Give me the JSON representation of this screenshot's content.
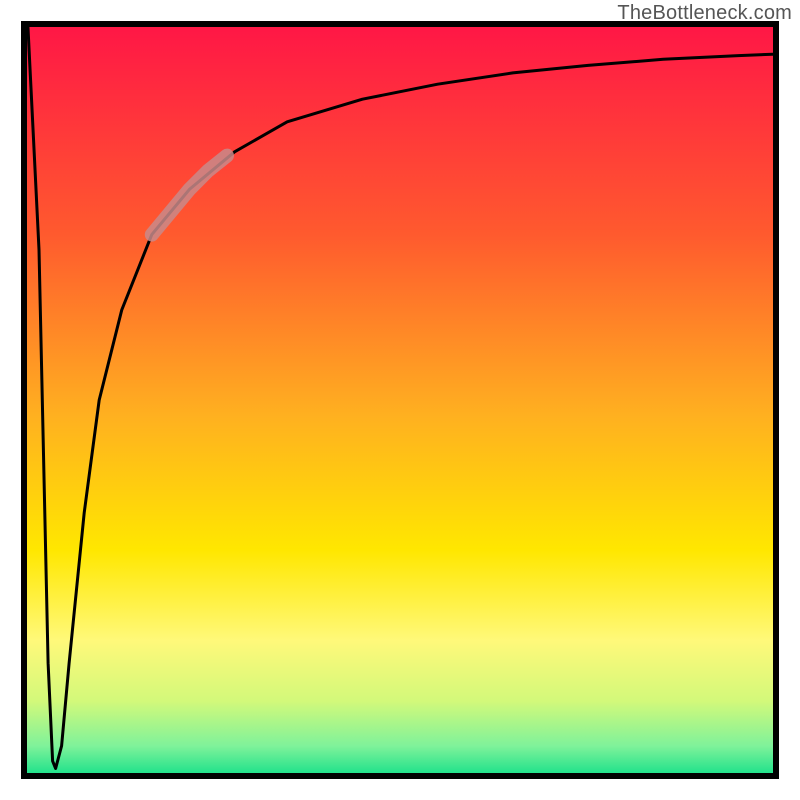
{
  "watermark": {
    "text": "TheBottleneck.com"
  },
  "chart_data": {
    "type": "line",
    "title": "",
    "xlabel": "",
    "ylabel": "",
    "xlim": [
      0,
      100
    ],
    "ylim": [
      0,
      100
    ],
    "grid": false,
    "legend": false,
    "gradient_stops": [
      {
        "offset": 0.0,
        "color": "#ff1646"
      },
      {
        "offset": 0.28,
        "color": "#ff5a2e"
      },
      {
        "offset": 0.52,
        "color": "#ffb020"
      },
      {
        "offset": 0.7,
        "color": "#ffe700"
      },
      {
        "offset": 0.82,
        "color": "#fff97a"
      },
      {
        "offset": 0.9,
        "color": "#d3f97a"
      },
      {
        "offset": 0.96,
        "color": "#7ff29a"
      },
      {
        "offset": 1.0,
        "color": "#18e08a"
      }
    ],
    "series": [
      {
        "name": "bottleneck-curve",
        "x": [
          0.5,
          2.0,
          3.2,
          3.8,
          4.2,
          5.0,
          6.0,
          8.0,
          10,
          13,
          17,
          22,
          28,
          35,
          45,
          55,
          65,
          75,
          85,
          95,
          100
        ],
        "y": [
          100,
          70,
          15,
          2,
          1,
          4,
          15,
          35,
          50,
          62,
          72,
          78,
          83,
          87,
          90,
          92,
          93.5,
          94.5,
          95.3,
          95.8,
          96
        ]
      },
      {
        "name": "highlight-segment",
        "x": [
          17,
          19.5,
          22,
          24.5,
          27
        ],
        "y": [
          72,
          75,
          78,
          80.5,
          82.5
        ]
      }
    ],
    "frame": {
      "stroke": "#000000",
      "stroke_width": 6
    }
  }
}
